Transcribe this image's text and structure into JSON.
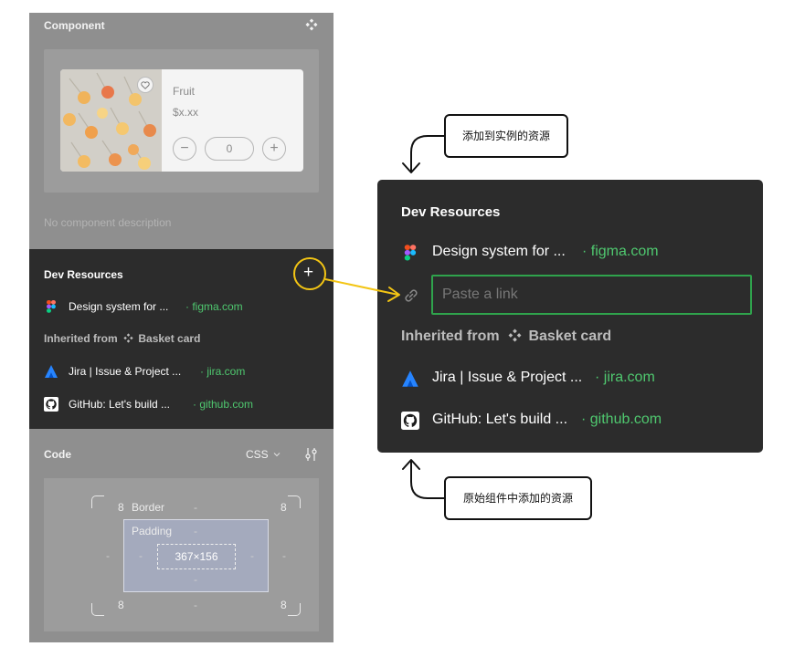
{
  "panel": {
    "component_title": "Component",
    "component_icon": "component-diamond-icon",
    "preview": {
      "name": "Fruit",
      "price": "$x.xx",
      "qty": "0",
      "minus": "−",
      "plus": "+"
    },
    "no_description": "No component description",
    "dev_resources": {
      "title": "Dev Resources",
      "add": "+",
      "items": [
        {
          "title": "Design system for ...",
          "link": "· figma.com",
          "icon": "figma-icon"
        }
      ],
      "inherited_label": "Inherited from",
      "inherited_component": "Basket card",
      "inherited_items": [
        {
          "title": "Jira | Issue & Project ...",
          "link": "· jira.com",
          "icon": "jira-icon"
        },
        {
          "title": "GitHub: Let's build ...",
          "link": "· github.com",
          "icon": "github-icon"
        }
      ]
    },
    "code": {
      "title": "Code",
      "language": "CSS"
    },
    "box_model": {
      "border_label": "Border",
      "padding_label": "Padding",
      "size": "367×156",
      "border_top_left": "8",
      "border_top_right": "8",
      "border_bottom_left": "8",
      "border_bottom_right": "8",
      "dash": "-"
    }
  },
  "zoom": {
    "title": "Dev Resources",
    "items": [
      {
        "title": "Design system for ...",
        "link": "· figma.com"
      }
    ],
    "input_placeholder": "Paste a link",
    "inherited_label": "Inherited from",
    "inherited_component": "Basket card",
    "inherited_items": [
      {
        "title": "Jira | Issue & Project ...",
        "link": "· jira.com"
      },
      {
        "title": "GitHub: Let's build ...",
        "link": "· github.com"
      }
    ]
  },
  "callouts": {
    "top": "添加到实例的资源",
    "bottom": "原始组件中添加的资源"
  },
  "colors": {
    "highlight": "#f3c514",
    "link_green": "#4fc86f",
    "input_border": "#2fa34c",
    "dark_panel": "#2c2c2c"
  }
}
